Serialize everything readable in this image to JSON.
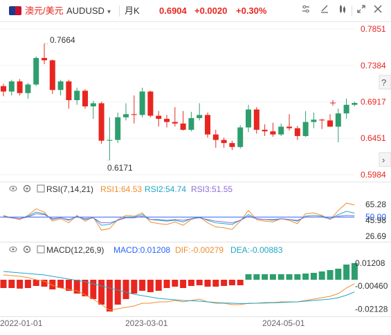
{
  "toolbar": {
    "symbol_name": "澳元/美元",
    "symbol_dropdown": "▾",
    "symbol": "AUDUSD",
    "period": "月K",
    "last": "0.6904",
    "change": "+0.0020",
    "change_pct": "+0.30%",
    "icons": [
      "settings-sliders-icon",
      "draw-tool-icon",
      "compare-icon",
      "expand-icon",
      "close-icon"
    ]
  },
  "colors": {
    "up": "#2e9e6e",
    "down": "#e8261f",
    "rsi1": "#f08c2e",
    "rsi2": "#1ea6c8",
    "rsi3": "#8c6cd8",
    "macd_dif": "#f08c2e",
    "macd_dea": "#1ea6c8",
    "rsi_mid": "#2962ff"
  },
  "chart_data": [
    {
      "type": "candlestick",
      "title": "AUDUSD 月K",
      "y_ticks": [
        "0.7851",
        "0.7384",
        "0.6917",
        "0.6451",
        "0.5984"
      ],
      "ylim": [
        0.5984,
        0.7851
      ],
      "annotations": {
        "high_label": "0.7664",
        "low_label": "0.6171"
      },
      "x_labels": [
        "2022-01-01",
        "2023-03-01",
        "2024-05-01"
      ],
      "last_price": 0.6904,
      "candles": [
        [
          0.712,
          0.715,
          0.699,
          0.705
        ],
        [
          0.705,
          0.72,
          0.7,
          0.718
        ],
        [
          0.718,
          0.721,
          0.7,
          0.703
        ],
        [
          0.703,
          0.716,
          0.696,
          0.714
        ],
        [
          0.714,
          0.75,
          0.712,
          0.748
        ],
        [
          0.748,
          0.7664,
          0.74,
          0.745
        ],
        [
          0.745,
          0.746,
          0.702,
          0.707
        ],
        [
          0.707,
          0.72,
          0.7,
          0.718
        ],
        [
          0.718,
          0.72,
          0.683,
          0.694
        ],
        [
          0.694,
          0.71,
          0.688,
          0.706
        ],
        [
          0.706,
          0.708,
          0.683,
          0.686
        ],
        [
          0.686,
          0.693,
          0.67,
          0.69
        ],
        [
          0.69,
          0.692,
          0.638,
          0.642
        ],
        [
          0.642,
          0.672,
          0.6171,
          0.643
        ],
        [
          0.643,
          0.678,
          0.639,
          0.672
        ],
        [
          0.672,
          0.69,
          0.668,
          0.676
        ],
        [
          0.676,
          0.7,
          0.664,
          0.675
        ],
        [
          0.675,
          0.71,
          0.672,
          0.705
        ],
        [
          0.705,
          0.706,
          0.672,
          0.674
        ],
        [
          0.674,
          0.68,
          0.66,
          0.67
        ],
        [
          0.67,
          0.675,
          0.659,
          0.666
        ],
        [
          0.666,
          0.685,
          0.66,
          0.664
        ],
        [
          0.664,
          0.68,
          0.655,
          0.656
        ],
        [
          0.656,
          0.679,
          0.654,
          0.671
        ],
        [
          0.671,
          0.69,
          0.668,
          0.675
        ],
        [
          0.675,
          0.678,
          0.646,
          0.65
        ],
        [
          0.65,
          0.656,
          0.633,
          0.643
        ],
        [
          0.643,
          0.646,
          0.633,
          0.639
        ],
        [
          0.639,
          0.642,
          0.63,
          0.634
        ],
        [
          0.634,
          0.662,
          0.632,
          0.659
        ],
        [
          0.659,
          0.688,
          0.653,
          0.682
        ],
        [
          0.682,
          0.685,
          0.651,
          0.656
        ],
        [
          0.656,
          0.663,
          0.648,
          0.654
        ],
        [
          0.654,
          0.665,
          0.647,
          0.65
        ],
        [
          0.65,
          0.664,
          0.648,
          0.66
        ],
        [
          0.66,
          0.676,
          0.655,
          0.658
        ],
        [
          0.658,
          0.661,
          0.643,
          0.648
        ],
        [
          0.648,
          0.68,
          0.647,
          0.666
        ],
        [
          0.666,
          0.678,
          0.658,
          0.669
        ],
        [
          0.669,
          0.67,
          0.657,
          0.668
        ],
        [
          0.668,
          0.676,
          0.66,
          0.66
        ],
        [
          0.66,
          0.683,
          0.64,
          0.677
        ],
        [
          0.677,
          0.696,
          0.67,
          0.688
        ],
        [
          0.688,
          0.692,
          0.686,
          0.6904
        ]
      ]
    },
    {
      "type": "line",
      "title": "RSI(7,14,21)",
      "legend": [
        {
          "name": "RSI1",
          "label": "RSI1:64.53"
        },
        {
          "name": "RSI2",
          "label": "RSI2:54.74"
        },
        {
          "name": "RSI3",
          "label": "RSI3:51.55"
        }
      ],
      "y_ticks": [
        "65.28",
        "50.00",
        "45.98",
        "26.69"
      ],
      "ylim": [
        26.69,
        72
      ],
      "reference_line": 50.0,
      "series": [
        {
          "name": "RSI1",
          "values": [
            52,
            49,
            47,
            52,
            60,
            56,
            45,
            48,
            43,
            52,
            45,
            50,
            34,
            36,
            47,
            52,
            51,
            55,
            44,
            42,
            41,
            44,
            40,
            47,
            50,
            43,
            38,
            37,
            35,
            45,
            58,
            47,
            45,
            44,
            48,
            46,
            42,
            54,
            55,
            52,
            47,
            58,
            67,
            64.53
          ]
        },
        {
          "name": "RSI2",
          "values": [
            51,
            49,
            48,
            51,
            56,
            54,
            47,
            49,
            46,
            51,
            47,
            49,
            40,
            41,
            46,
            50,
            50,
            53,
            47,
            46,
            45,
            46,
            44,
            48,
            50,
            46,
            43,
            42,
            41,
            46,
            53,
            48,
            47,
            46,
            48,
            47,
            45,
            51,
            52,
            51,
            48,
            53,
            57,
            54.74
          ]
        },
        {
          "name": "RSI3",
          "values": [
            50,
            49,
            48,
            50,
            54,
            53,
            48,
            49,
            47,
            50,
            48,
            49,
            43,
            43,
            46,
            49,
            49,
            51,
            47,
            47,
            46,
            47,
            46,
            48,
            49,
            47,
            45,
            44,
            43,
            46,
            51,
            48,
            47,
            47,
            48,
            47,
            46,
            50,
            50,
            50,
            48,
            51,
            52,
            51.55
          ]
        }
      ]
    },
    {
      "type": "bar",
      "title": "MACD(12,26,9)",
      "legend": [
        {
          "name": "MACD",
          "label": "MACD:0.01208"
        },
        {
          "name": "DIF",
          "label": "DIF:-0.00279"
        },
        {
          "name": "DEA",
          "label": "DEA:-0.00883"
        }
      ],
      "y_ticks": [
        "0.01208",
        "-0.00460",
        "-0.02128"
      ],
      "ylim": [
        -0.0245,
        0.0145
      ],
      "macd": [
        -0.006,
        -0.006,
        -0.0064,
        -0.006,
        -0.0045,
        -0.005,
        -0.007,
        -0.006,
        -0.008,
        -0.01,
        -0.012,
        -0.014,
        -0.018,
        -0.023,
        -0.018,
        -0.014,
        -0.01,
        -0.008,
        -0.009,
        -0.008,
        -0.006,
        -0.005,
        -0.006,
        -0.0045,
        -0.004,
        -0.005,
        -0.005,
        -0.0045,
        -0.004,
        -0.004,
        0.004,
        0.004,
        0.004,
        0.004,
        0.004,
        0.004,
        0.004,
        0.0045,
        0.005,
        0.006,
        0.007,
        0.008,
        0.011,
        0.01208
      ],
      "dif": [
        0.0035,
        0.003,
        0.0025,
        0.0015,
        0.0,
        -0.001,
        -0.004,
        -0.006,
        -0.007,
        -0.008,
        -0.011,
        -0.014,
        -0.018,
        -0.022,
        -0.021,
        -0.02,
        -0.019,
        -0.017,
        -0.017,
        -0.016,
        -0.016,
        -0.015,
        -0.016,
        -0.015,
        -0.014,
        -0.016,
        -0.017,
        -0.017,
        -0.018,
        -0.018,
        -0.017,
        -0.017,
        -0.0165,
        -0.0165,
        -0.016,
        -0.016,
        -0.016,
        -0.015,
        -0.014,
        -0.013,
        -0.012,
        -0.01,
        -0.006,
        -0.00279
      ],
      "dea": [
        0.006,
        0.0055,
        0.005,
        0.0045,
        0.004,
        0.0035,
        0.0025,
        0.0015,
        0.0005,
        -0.0005,
        -0.0015,
        -0.003,
        -0.0045,
        -0.006,
        -0.0075,
        -0.009,
        -0.0105,
        -0.0115,
        -0.0125,
        -0.0135,
        -0.014,
        -0.0145,
        -0.015,
        -0.0152,
        -0.0155,
        -0.016,
        -0.0165,
        -0.0168,
        -0.017,
        -0.0172,
        -0.0172,
        -0.017,
        -0.0169,
        -0.0167,
        -0.0165,
        -0.0162,
        -0.016,
        -0.0155,
        -0.015,
        -0.0145,
        -0.014,
        -0.013,
        -0.0112,
        -0.00883
      ]
    }
  ]
}
